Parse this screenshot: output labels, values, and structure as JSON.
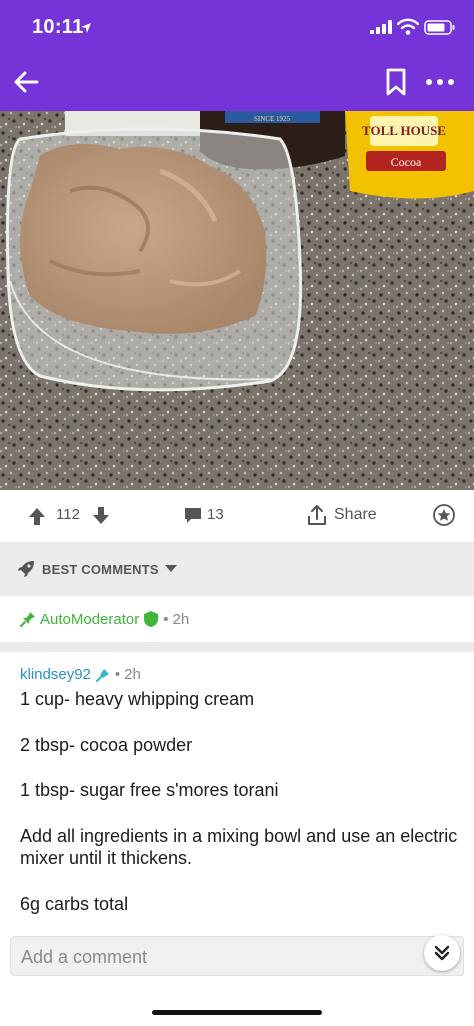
{
  "status_bar": {
    "time": "10:11"
  },
  "colors": {
    "header": "#7434d8",
    "upvote": "#555555",
    "mod_green": "#3fb53a",
    "username_blue": "#2b91c9",
    "muted": "#888888"
  },
  "nav": {
    "back_icon": "arrow-left-icon",
    "bookmark_icon": "bookmark-icon",
    "more_icon": "more-dots-icon"
  },
  "post": {
    "image_alt_labels": {
      "can_brand": "TOLL HOUSE",
      "can_label": "Cocoa",
      "jar_label": "SINCE 1925"
    },
    "score": "112",
    "comment_count": "13",
    "share_label": "Share"
  },
  "comments_sort": {
    "label": "BEST COMMENTS"
  },
  "automod": {
    "name": "AutoModerator",
    "separator": "•",
    "age": "2h"
  },
  "comment": {
    "author": "klindsey92",
    "separator": "•",
    "age": "2h",
    "lines": [
      "1 cup- heavy whipping cream",
      "2 tbsp- cocoa powder",
      "1 tbsp- sugar free s'mores torani",
      "Add all ingredients in a mixing bowl and use an electric mixer until it thickens.",
      "6g carbs total"
    ]
  },
  "reply": {
    "placeholder": "Add a comment"
  }
}
